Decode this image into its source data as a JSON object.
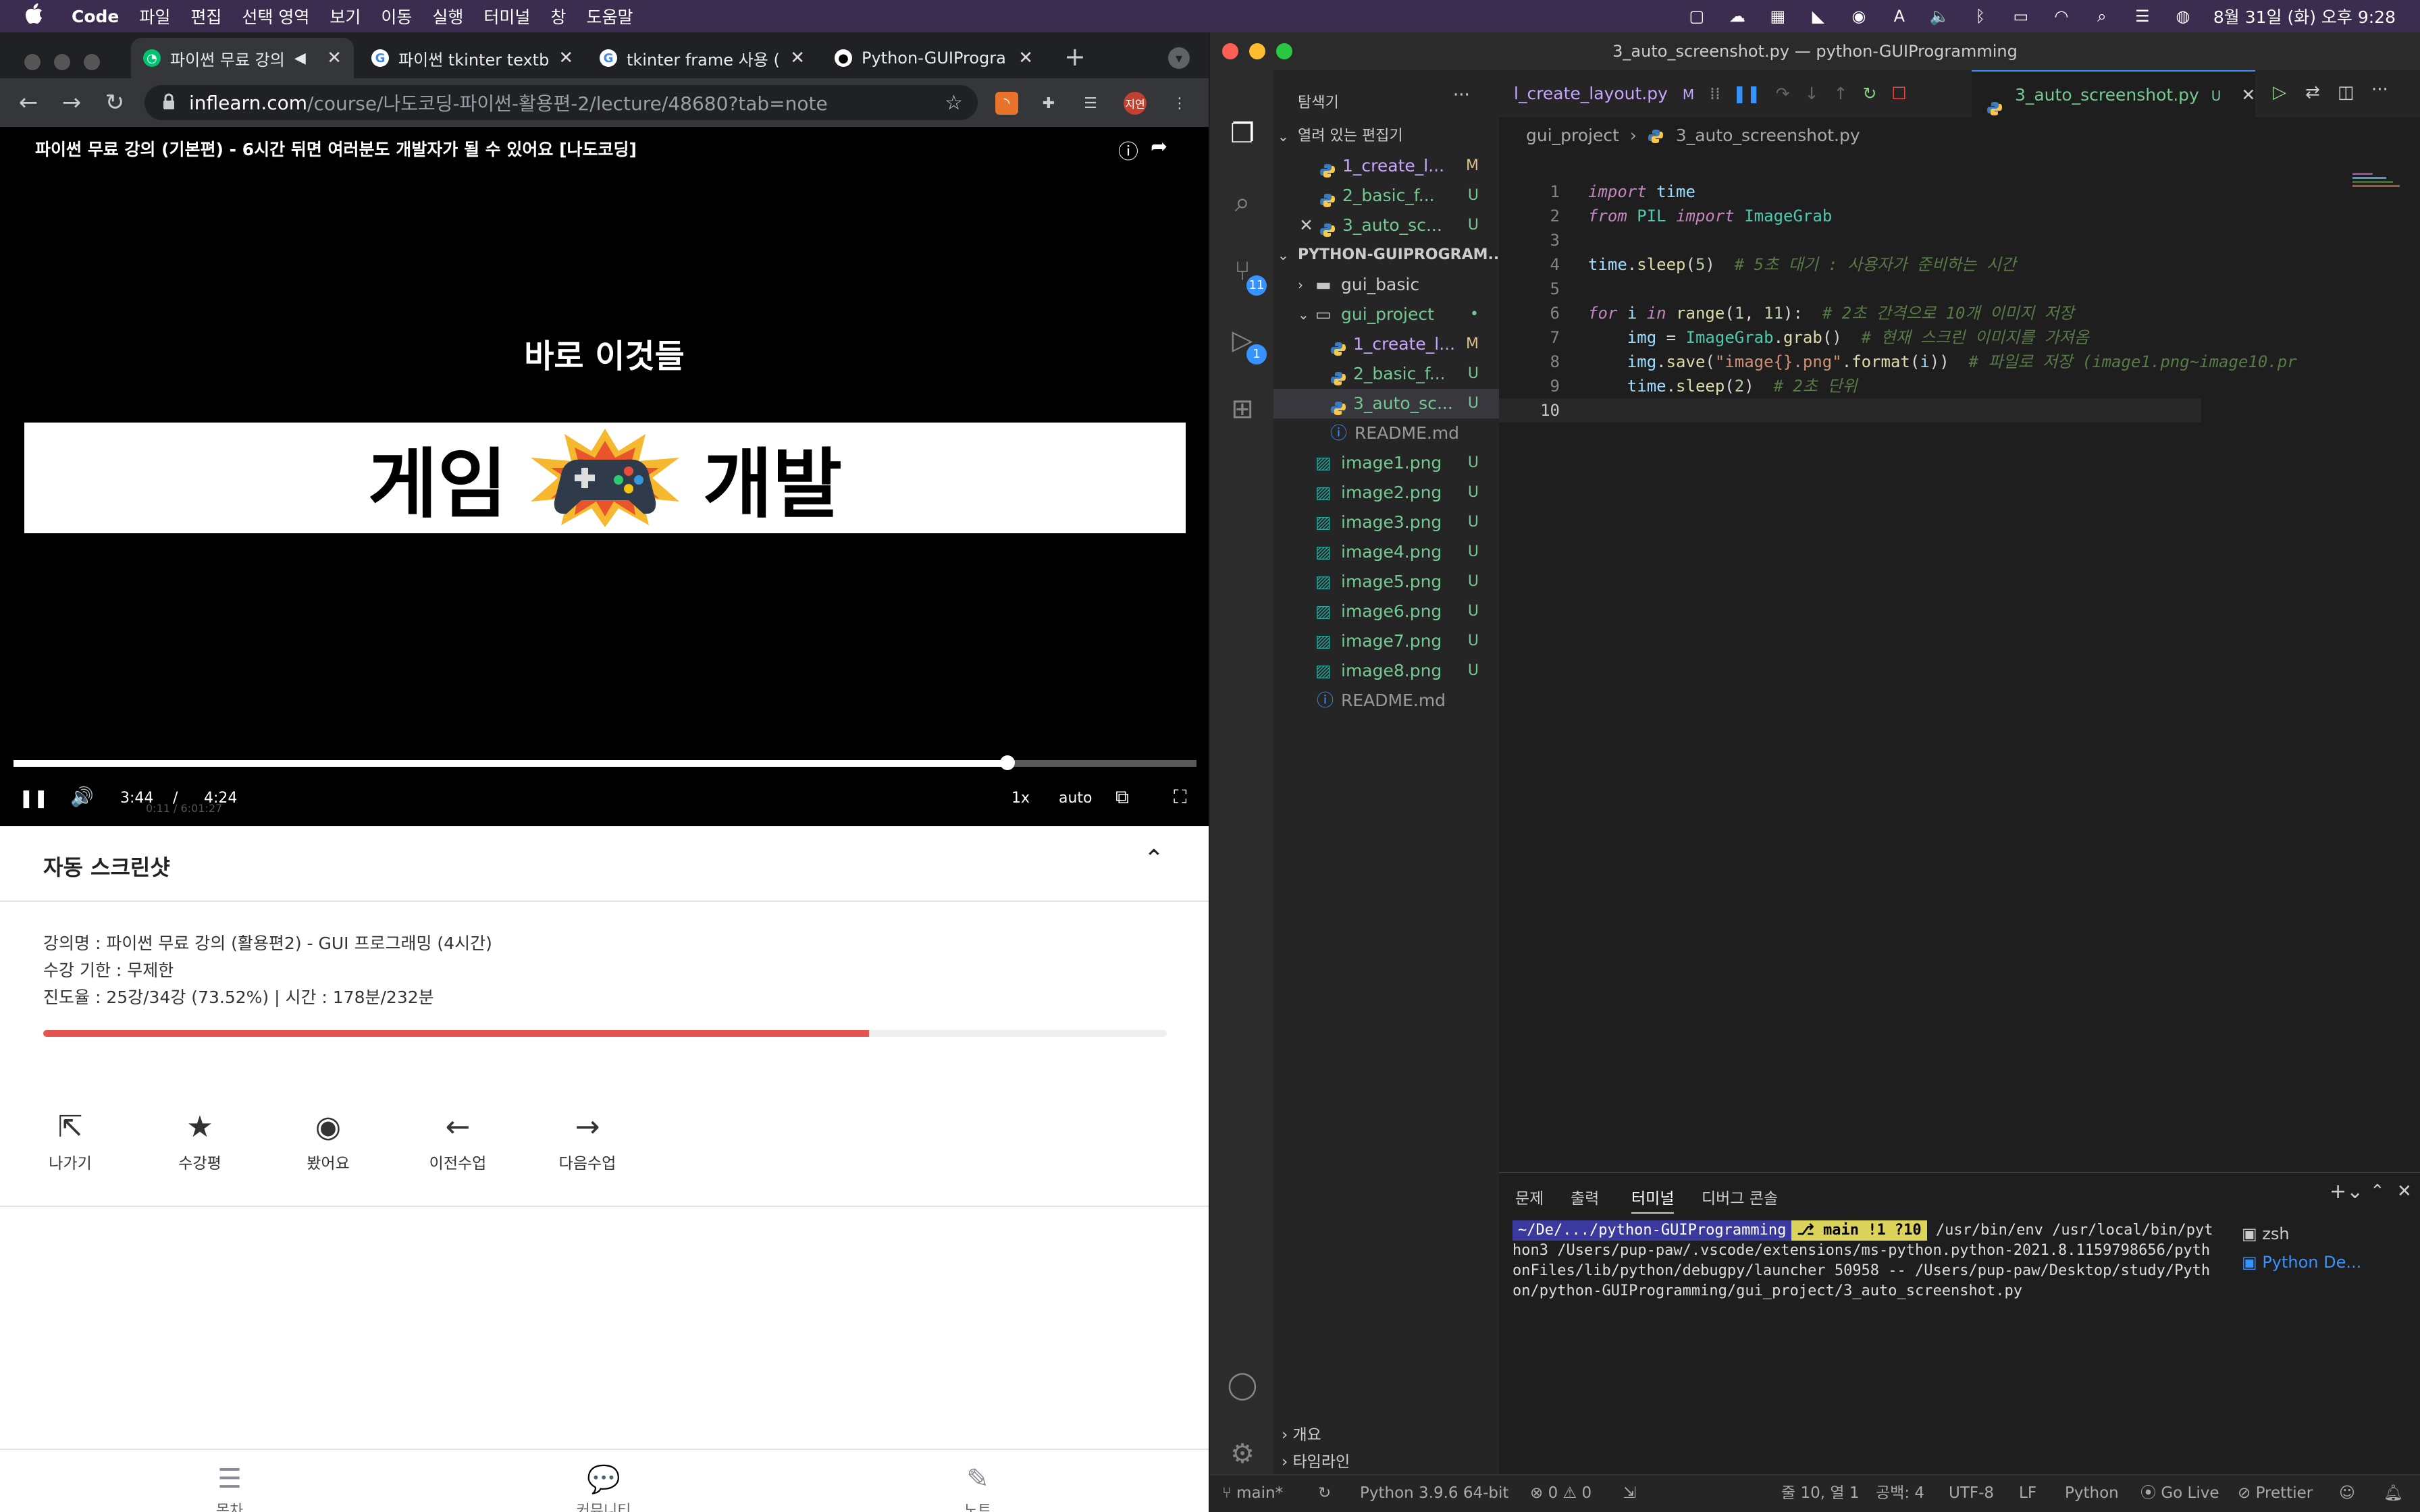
{
  "menubar": {
    "app": "Code",
    "items": [
      "파일",
      "편집",
      "선택 영역",
      "보기",
      "이동",
      "실행",
      "터미널",
      "창",
      "도움말"
    ],
    "clock": "8월 31일 (화) 오후 9:28"
  },
  "browser": {
    "tabs": [
      {
        "title": "파이썬 무료 강의",
        "active": true
      },
      {
        "title": "파이썬 tkinter textb",
        "active": false
      },
      {
        "title": "tkinter frame 사용 (",
        "active": false
      },
      {
        "title": "Python-GUIProgra",
        "active": false
      }
    ],
    "url_host": "inflearn.com",
    "url_path": "/course/나도코딩-파이썬-활용편-2/lecture/48680?tab=note",
    "profile": "지연",
    "video": {
      "title": "파이썬 무료 강의 (기본편) - 6시간 뒤면 여러분도 개발자가 될 수 있어요 [나도코딩]",
      "slide_title": "바로 이것들",
      "banner_left": "게임",
      "banner_right": "개발",
      "time_current": "3:44",
      "time_sep": "/",
      "time_total": "4:24",
      "progress": 0.84,
      "speed": "1x",
      "quality": "auto",
      "ghost_time": "0:11 / 6:01:27"
    },
    "lecture": {
      "title": "자동 스크린샷",
      "info": [
        "강의명 : 파이썬 무료 강의 (활용편2) - GUI 프로그래밍 (4시간)",
        "수강 기한 : 무제한",
        "진도율 : 25강/34강 (73.52%) | 시간 : 178분/232분"
      ],
      "progress": 0.7352,
      "progress_color": "#e5554f",
      "actions": [
        "나가기",
        "수강평",
        "봤어요",
        "이전수업",
        "다음수업"
      ]
    },
    "bottom_nav": [
      "목차",
      "커뮤니티",
      "노트"
    ]
  },
  "vscode": {
    "title": "3_auto_screenshot.py — python-GUIProgramming",
    "explorer_title": "탐색기",
    "open_editors_label": "열려 있는 편집기",
    "open_editors": [
      {
        "name": "1_create_l...",
        "status": "M"
      },
      {
        "name": "2_basic_f...",
        "status": "U"
      },
      {
        "name": "3_auto_sc...",
        "status": "U"
      }
    ],
    "project_label": "PYTHON-GUIPROGRAM...",
    "tree": [
      {
        "name": "gui_basic",
        "type": "folder",
        "status": ""
      },
      {
        "name": "gui_project",
        "type": "folder-open",
        "status": "•"
      },
      {
        "name": "1_create_l...",
        "type": "py",
        "status": "M"
      },
      {
        "name": "2_basic_f...",
        "type": "py",
        "status": "U"
      },
      {
        "name": "3_auto_sc...",
        "type": "py",
        "status": "U"
      },
      {
        "name": "README.md",
        "type": "info",
        "status": ""
      },
      {
        "name": "image1.png",
        "type": "img",
        "status": "U"
      },
      {
        "name": "image2.png",
        "type": "img",
        "status": "U"
      },
      {
        "name": "image3.png",
        "type": "img",
        "status": "U"
      },
      {
        "name": "image4.png",
        "type": "img",
        "status": "U"
      },
      {
        "name": "image5.png",
        "type": "img",
        "status": "U"
      },
      {
        "name": "image6.png",
        "type": "img",
        "status": "U"
      },
      {
        "name": "image7.png",
        "type": "img",
        "status": "U"
      },
      {
        "name": "image8.png",
        "type": "img",
        "status": "U"
      },
      {
        "name": "README.md",
        "type": "info",
        "status": ""
      }
    ],
    "tabs": [
      {
        "name": "l_create_layout.py",
        "status": "M"
      },
      {
        "name": "3_auto_screenshot.py",
        "status": "U"
      }
    ],
    "breadcrumb": [
      "gui_project",
      "3_auto_screenshot.py"
    ],
    "code": [
      "import time",
      "from PIL import ImageGrab",
      "",
      "time.sleep(5)  # 5초 대기 : 사용자가 준비하는 시간",
      "",
      "for i in range(1, 11):  # 2초 간격으로 10개 이미지 저장",
      "    img = ImageGrab.grab()  # 현재 스크린 이미지를 가져옴",
      "    img.save(\"image{}.png\".format(i))  # 파일로 저장 (image1.png~image10.pr",
      "    time.sleep(2)  # 2초 단위",
      ""
    ],
    "panel_tabs": [
      "문제",
      "출력",
      "터미널",
      "디버그 콘솔"
    ],
    "terminal": {
      "prompt_path": "~/De/.../python-GUIProgramming",
      "git": "main !1 ?10",
      "command": "/usr/bin/env /usr/local/bin/python3 /Users/pup-paw/.vscode/extensions/ms-python.python-2021.8.1159798656/pythonFiles/lib/python/debugpy/launcher 50958 -- /Users/pup-paw/Desktop/study/Python/python-GUIProgramming/gui_project/3_auto_screenshot.py"
    },
    "terminals": [
      "zsh",
      "Python De..."
    ],
    "outline": [
      "개요",
      "타임라인"
    ],
    "status": {
      "branch": "main*",
      "python": "Python 3.9.6 64-bit",
      "problems": "⊗ 0 ⚠ 0",
      "position": "줄 10, 열 1",
      "spaces": "공백: 4",
      "encoding": "UTF-8",
      "eol": "LF",
      "language": "Python",
      "golive": "Go Live",
      "prettier": "Prettier"
    },
    "badges": {
      "scm": "11",
      "debug": "1"
    }
  }
}
